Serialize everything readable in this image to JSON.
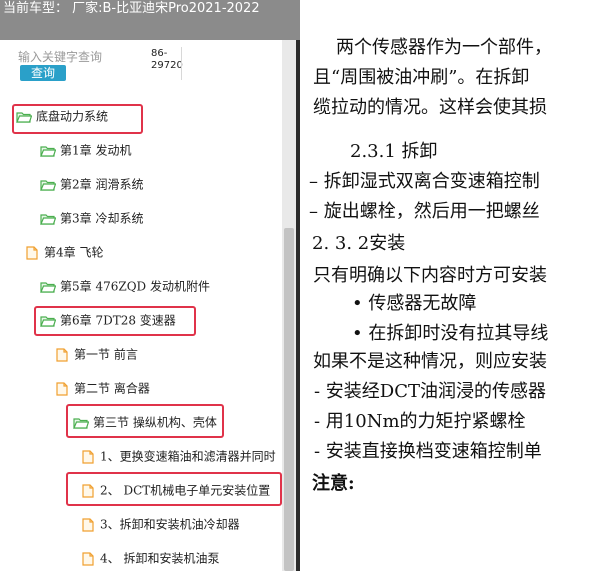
{
  "topbar": {
    "title": "当前车型： 厂家:B-比亚迪宋Pro2021-2022"
  },
  "search": {
    "placeholder": "输入关键字查询",
    "button_label": "查询"
  },
  "doc_code": "86-\n29720",
  "tree": {
    "items": [
      {
        "label": "底盘动力系统",
        "icon": "folder"
      },
      {
        "label": "第1章 发动机",
        "icon": "folder"
      },
      {
        "label": "第2章 润滑系统",
        "icon": "folder"
      },
      {
        "label": "第3章 冷却系统",
        "icon": "folder"
      },
      {
        "label": "第4章 飞轮",
        "icon": "file"
      },
      {
        "label": "第5章 476ZQD 发动机附件",
        "icon": "folder"
      },
      {
        "label": "第6章 7DT28 变速器",
        "icon": "folder"
      },
      {
        "label": "第一节 前言",
        "icon": "file"
      },
      {
        "label": "第二节 离合器",
        "icon": "file"
      },
      {
        "label": "第三节 操纵机构、壳体",
        "icon": "folder"
      },
      {
        "label": "1、更换变速箱油和滤清器并同时",
        "icon": "file"
      },
      {
        "label": "2、 DCT机械电子单元安装位置",
        "icon": "file"
      },
      {
        "label": "3、拆卸和安装机油冷却器",
        "icon": "file"
      },
      {
        "label": "4、 拆卸和安装机油泵",
        "icon": "file"
      }
    ]
  },
  "document": {
    "lines": [
      "两个传感器作为一个部件，",
      "且“周围被油冲刷”。在拆卸",
      "缆拉动的情况。这样会使其损",
      "2.3.1  拆卸",
      "– 拆卸湿式双离合变速箱控制",
      "– 旋出螺栓，然后用一把螺丝",
      "2. 3. 2安装",
      "只有明确以下内容时方可安装",
      "• 传感器无故障",
      "• 在拆卸时没有拉其导线",
      "如果不是这种情况，则应安装",
      "- 安装经DCT油润浸的传感器",
      "- 用10Nm的力矩拧紧螺栓",
      "- 安装直接换档变速箱控制单",
      "注意:"
    ]
  },
  "colors": {
    "highlight": "#e0334a",
    "folder": "#4caf50",
    "file": "#f0a030",
    "search_button": "#2aa0c9"
  }
}
